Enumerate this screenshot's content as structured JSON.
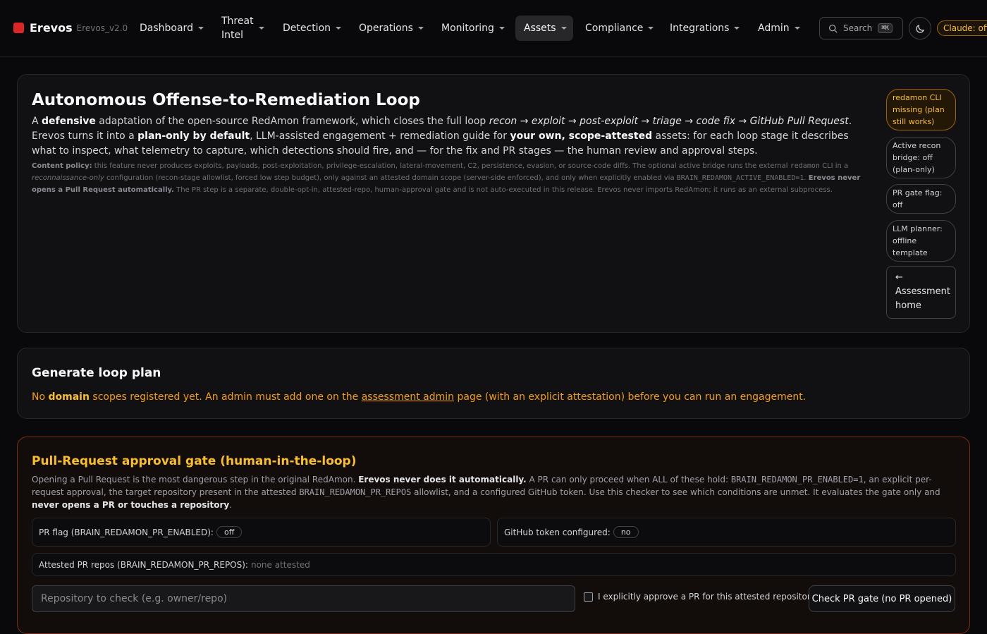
{
  "nav": {
    "brand": "Erevos",
    "version": "Erevos_v2.0",
    "items": [
      {
        "label": "Dashboard"
      },
      {
        "label": "Threat Intel"
      },
      {
        "label": "Detection"
      },
      {
        "label": "Operations"
      },
      {
        "label": "Monitoring"
      },
      {
        "label": "Assets"
      },
      {
        "label": "Compliance"
      },
      {
        "label": "Integrations"
      },
      {
        "label": "Admin"
      }
    ],
    "active": "Assets",
    "search_label": "Search",
    "search_shortcut": "⌘K",
    "claude_badge": "Claude: off"
  },
  "hero": {
    "title": "Autonomous Offense-to-Remediation Loop",
    "intro": {
      "a": "A ",
      "defensive": "defensive",
      "b": " adaptation of the open-source RedAmon framework, which closes the full loop ",
      "loop": "recon → exploit → post-exploit → triage → code fix → GitHub Pull Request",
      "c": ". Erevos turns it into a ",
      "plan_only": "plan-only by default",
      "d": ", LLM-assisted engagement + remediation guide for ",
      "own": "your own, scope-attested",
      "e": " assets: for each loop stage it describes what to inspect, what telemetry to capture, which detections should fire, and — for the fix and PR stages — the human review and approval steps."
    },
    "policy": {
      "label": "Content policy:",
      "a": " this feature never produces exploits, payloads, post-exploitation, privilege-escalation, lateral-movement, C2, persistence, evasion, or source-code diffs. The optional active bridge runs the external ",
      "cli": "redamon",
      "b": " CLI in a ",
      "recon_only": "reconnaissance-only",
      "c": " configuration (recon-stage allowlist, forced low step budget), only against an attested domain scope (server-side enforced), and only when explicitly enabled via ",
      "env": "BRAIN_REDAMON_ACTIVE_ENABLED=1",
      "d": ". ",
      "never_pr": "Erevos never opens a Pull Request automatically.",
      "e": " The PR step is a separate, double-opt-in, attested-repo, human-approval gate and is not auto-executed in this release. Erevos never imports RedAmon; it runs as an external subprocess."
    },
    "status_pills": [
      "redamon CLI missing (plan still works)",
      "Active recon bridge: off (plan-only)",
      "PR gate flag: off",
      "LLM planner: offline template"
    ],
    "back_arrow": "←",
    "back_label": "Assessment home"
  },
  "generate": {
    "title": "Generate loop plan",
    "a": "No ",
    "domain": "domain",
    "b": " scopes registered yet. An admin must add one on the ",
    "link": "assessment admin",
    "c": " page (with an explicit attestation) before you can run an engagement."
  },
  "gate": {
    "title": "Pull-Request approval gate (human-in-the-loop)",
    "desc": {
      "a": "Opening a Pull Request is the most dangerous step in the original RedAmon. ",
      "never": "Erevos never does it automatically.",
      "b": " A PR can only proceed when ALL of these hold: ",
      "env1": "BRAIN_REDAMON_PR_ENABLED=1",
      "c": ", an explicit per-request approval, the target repository present in the attested ",
      "env2": "BRAIN_REDAMON_PR_REPOS",
      "d": " allowlist, and a configured GitHub token. Use this checker to see which conditions are unmet. It evaluates the gate only and ",
      "never2": "never opens a PR or touches a repository",
      "e": "."
    },
    "pr_flag_label": "PR flag (BRAIN_REDAMON_PR_ENABLED):",
    "pr_flag_value": "off",
    "token_label": "GitHub token configured:",
    "token_value": "no",
    "repos_label": "Attested PR repos (BRAIN_REDAMON_PR_REPOS):",
    "repos_value": "none attested",
    "repo_placeholder": "Repository to check (e.g. owner/repo)",
    "approve_label": "I explicitly approve a PR for this attested repository",
    "check_button": "Check PR gate (no PR opened)"
  }
}
